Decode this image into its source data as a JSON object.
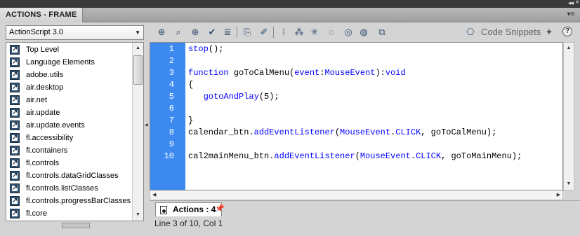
{
  "window": {
    "panel_title": "ACTIONS - FRAME",
    "collapse_glyph": "◂◂",
    "close_glyph": "×",
    "panel_menu_glyph": "▾≡"
  },
  "sidebar": {
    "language_select": "ActionScript 3.0",
    "items": [
      {
        "label": "Top Level"
      },
      {
        "label": "Language Elements"
      },
      {
        "label": "adobe.utils"
      },
      {
        "label": "air.desktop"
      },
      {
        "label": "air.net"
      },
      {
        "label": "air.update"
      },
      {
        "label": "air.update.events"
      },
      {
        "label": "fl.accessibility"
      },
      {
        "label": "fl.containers"
      },
      {
        "label": "fl.controls"
      },
      {
        "label": "fl.controls.dataGridClasses"
      },
      {
        "label": "fl.controls.listClasses"
      },
      {
        "label": "fl.controls.progressBarClasses"
      },
      {
        "label": "fl.core"
      }
    ]
  },
  "toolbar": {
    "icons": [
      "add-script-item-icon",
      "find-icon",
      "target-path-icon",
      "check-syntax-icon",
      "auto-format-icon",
      "code-hint-icon",
      "debug-options-icon",
      "collapse-between-braces-icon",
      "collapse-selection-icon",
      "expand-all-icon",
      "apply-block-comment-icon",
      "apply-line-comment-icon",
      "remove-comment-icon",
      "show-hide-toolbox-icon"
    ],
    "code_snippets_label": "Code Snippets",
    "help_label": "?"
  },
  "editor": {
    "line_numbers": [
      "1",
      "2",
      "3",
      "4",
      "5",
      "6",
      "7",
      "8",
      "9",
      "10"
    ],
    "lines": [
      [
        {
          "t": "stop",
          "c": "fn"
        },
        {
          "t": "();",
          "c": "nm"
        }
      ],
      [],
      [
        {
          "t": "function",
          "c": "kw"
        },
        {
          "t": " goToCalMenu(",
          "c": "nm"
        },
        {
          "t": "event",
          "c": "kw"
        },
        {
          "t": ":",
          "c": "nm"
        },
        {
          "t": "MouseEvent",
          "c": "ty"
        },
        {
          "t": "):",
          "c": "nm"
        },
        {
          "t": "void",
          "c": "kw"
        }
      ],
      [
        {
          "t": "{",
          "c": "nm"
        }
      ],
      [
        {
          "t": "   ",
          "c": "nm"
        },
        {
          "t": "gotoAndPlay",
          "c": "fn"
        },
        {
          "t": "(5);",
          "c": "nm"
        }
      ],
      [],
      [
        {
          "t": "}",
          "c": "nm"
        }
      ],
      [
        {
          "t": "calendar_btn.",
          "c": "nm"
        },
        {
          "t": "addEventListener",
          "c": "fn"
        },
        {
          "t": "(",
          "c": "nm"
        },
        {
          "t": "MouseEvent",
          "c": "ty"
        },
        {
          "t": ".",
          "c": "nm"
        },
        {
          "t": "CLICK",
          "c": "ty"
        },
        {
          "t": ", goToCalMenu);",
          "c": "nm"
        }
      ],
      [],
      [
        {
          "t": "cal2mainMenu_btn.",
          "c": "nm"
        },
        {
          "t": "addEventListener",
          "c": "fn"
        },
        {
          "t": "(",
          "c": "nm"
        },
        {
          "t": "MouseEvent",
          "c": "ty"
        },
        {
          "t": ".",
          "c": "nm"
        },
        {
          "t": "CLICK",
          "c": "ty"
        },
        {
          "t": ", goToMainMenu);",
          "c": "nm"
        }
      ]
    ]
  },
  "script_tab": {
    "label": "Actions : 4"
  },
  "status": {
    "text": "Line 3 of 10, Col 1"
  },
  "colors": {
    "gutter": "#3c8af0",
    "keyword": "#0000ff"
  }
}
